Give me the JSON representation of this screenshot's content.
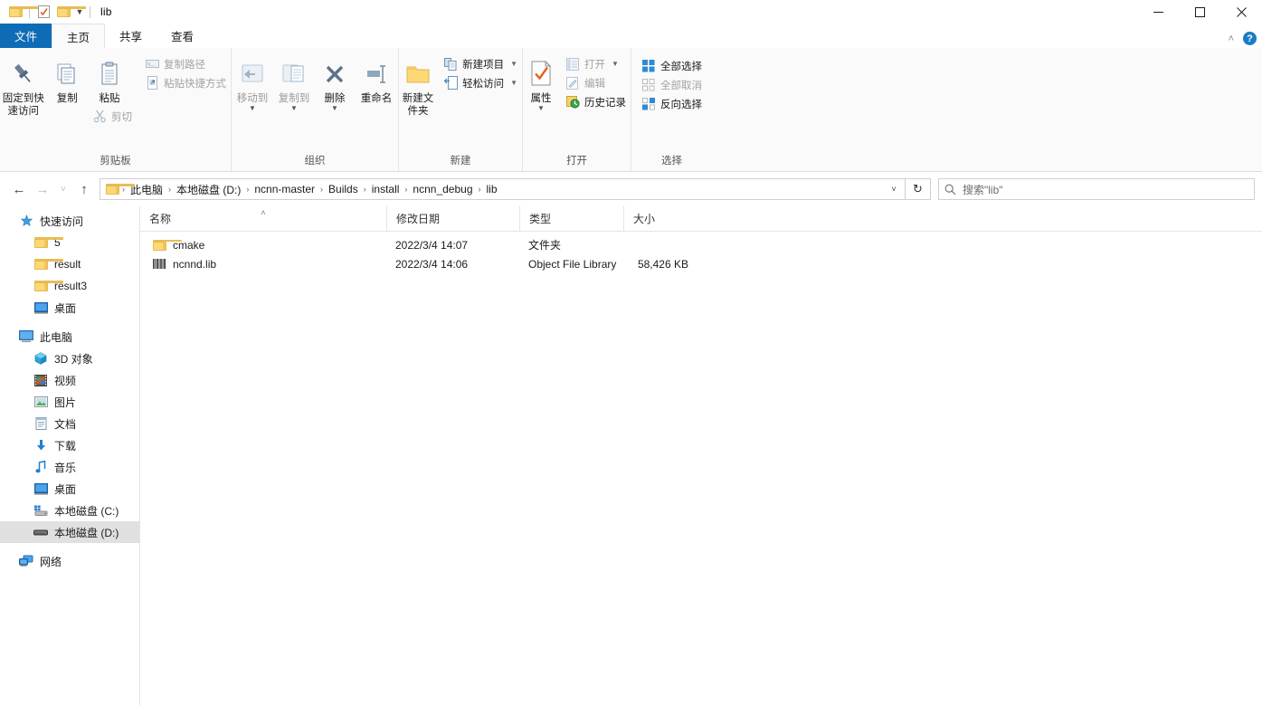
{
  "window": {
    "title": "lib",
    "quick_access": [
      "folder-icon",
      "properties-icon",
      "new-folder-icon"
    ],
    "minimize": "─",
    "maximize": "□",
    "close": "✕"
  },
  "tabs": [
    {
      "label": "文件",
      "id": "file"
    },
    {
      "label": "主页",
      "id": "home"
    },
    {
      "label": "共享",
      "id": "share"
    },
    {
      "label": "查看",
      "id": "view"
    }
  ],
  "tabstrip_right": {
    "collapse": "˄",
    "help": "?"
  },
  "ribbon": {
    "groups": [
      {
        "label": "剪贴板",
        "big": [
          {
            "label": "固定到快速访问",
            "icon": "pin-icon",
            "dim": false
          },
          {
            "label": "复制",
            "icon": "copy-icon",
            "dim": false
          },
          {
            "label": "粘贴",
            "icon": "paste-icon",
            "dim": false
          }
        ],
        "small": [
          {
            "label": "复制路径",
            "icon": "copy-path-icon",
            "dim": true
          },
          {
            "label": "粘贴快捷方式",
            "icon": "paste-shortcut-icon",
            "dim": true
          }
        ],
        "under_paste": {
          "label": "剪切",
          "icon": "scissors-icon",
          "dim": true
        }
      },
      {
        "label": "组织",
        "big": [
          {
            "label": "移动到",
            "icon": "move-to-icon",
            "dim": true,
            "dropdown": true
          },
          {
            "label": "复制到",
            "icon": "copy-to-icon",
            "dim": true,
            "dropdown": true
          },
          {
            "label": "删除",
            "icon": "delete-icon",
            "dim": false,
            "dropdown": true
          },
          {
            "label": "重命名",
            "icon": "rename-icon",
            "dim": false
          }
        ]
      },
      {
        "label": "新建",
        "big": [
          {
            "label": "新建文件夹",
            "icon": "new-folder-icon",
            "dim": false
          }
        ],
        "small": [
          {
            "label": "新建项目",
            "icon": "new-item-icon",
            "dim": false,
            "dropdown": true
          },
          {
            "label": "轻松访问",
            "icon": "easy-access-icon",
            "dim": false,
            "dropdown": true
          }
        ]
      },
      {
        "label": "打开",
        "big": [
          {
            "label": "属性",
            "icon": "properties-icon",
            "dim": false,
            "dropdown": true
          }
        ],
        "small": [
          {
            "label": "打开",
            "icon": "open-icon",
            "dim": true,
            "dropdown": true
          },
          {
            "label": "编辑",
            "icon": "edit-icon",
            "dim": true
          },
          {
            "label": "历史记录",
            "icon": "history-icon",
            "dim": false
          }
        ]
      },
      {
        "label": "选择",
        "small": [
          {
            "label": "全部选择",
            "icon": "select-all-icon",
            "dim": false
          },
          {
            "label": "全部取消",
            "icon": "select-none-icon",
            "dim": true
          },
          {
            "label": "反向选择",
            "icon": "invert-selection-icon",
            "dim": false
          }
        ]
      }
    ]
  },
  "address": {
    "back": "←",
    "forward": "→",
    "recent": "˅",
    "up": "↑",
    "breadcrumbs": [
      "此电脑",
      "本地磁盘 (D:)",
      "ncnn-master",
      "Builds",
      "install",
      "ncnn_debug",
      "lib"
    ],
    "separator": "›",
    "dropdown": "˅",
    "refresh": "↻"
  },
  "search": {
    "placeholder": "搜索\"lib\"",
    "icon": "search-icon"
  },
  "navpane": {
    "sections": [
      {
        "header": {
          "label": "快速访问",
          "icon": "star-pin-icon"
        },
        "items": [
          {
            "label": "5",
            "icon": "folder-icon"
          },
          {
            "label": "result",
            "icon": "folder-icon"
          },
          {
            "label": "result3",
            "icon": "folder-icon"
          },
          {
            "label": "桌面",
            "icon": "desktop-icon"
          }
        ]
      },
      {
        "header": {
          "label": "此电脑",
          "icon": "this-pc-icon"
        },
        "items": [
          {
            "label": "3D 对象",
            "icon": "3d-objects-icon"
          },
          {
            "label": "视频",
            "icon": "videos-icon"
          },
          {
            "label": "图片",
            "icon": "pictures-icon"
          },
          {
            "label": "文档",
            "icon": "documents-icon"
          },
          {
            "label": "下载",
            "icon": "downloads-icon"
          },
          {
            "label": "音乐",
            "icon": "music-icon"
          },
          {
            "label": "桌面",
            "icon": "desktop-icon"
          },
          {
            "label": "本地磁盘 (C:)",
            "icon": "system-drive-icon"
          },
          {
            "label": "本地磁盘 (D:)",
            "icon": "drive-icon",
            "selected": true
          }
        ]
      },
      {
        "header": {
          "label": "网络",
          "icon": "network-icon"
        },
        "items": []
      }
    ]
  },
  "filelist": {
    "columns": [
      {
        "label": "名称",
        "sorted": "asc"
      },
      {
        "label": "修改日期"
      },
      {
        "label": "类型"
      },
      {
        "label": "大小"
      }
    ],
    "sort_caret": "˄",
    "rows": [
      {
        "name": "cmake",
        "date": "2022/3/4 14:07",
        "type": "文件夹",
        "size": "",
        "icon": "folder-icon"
      },
      {
        "name": "ncnnd.lib",
        "date": "2022/3/4 14:06",
        "type": "Object File Library",
        "size": "58,426 KB",
        "icon": "lib-file-icon"
      }
    ]
  },
  "colors": {
    "file_tab_blue": "#0d6cb5",
    "folder_yellow": "#fcd975",
    "selection_gray": "#e0e0e0",
    "accent_blue": "#1a7bc4"
  }
}
